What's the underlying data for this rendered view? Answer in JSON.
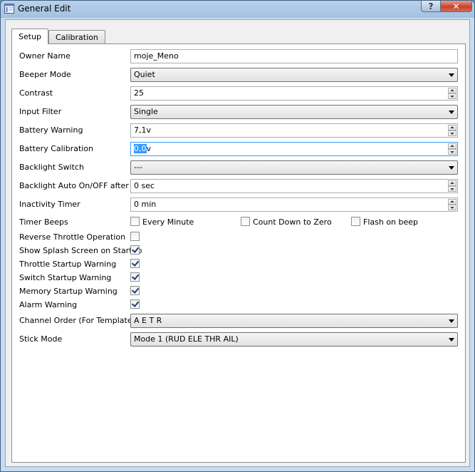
{
  "window": {
    "title": "General Edit",
    "help_label": "?",
    "close_label": "✕"
  },
  "tabs": [
    {
      "label": "Setup",
      "active": true
    },
    {
      "label": "Calibration",
      "active": false
    }
  ],
  "form": {
    "owner_name": {
      "label": "Owner Name",
      "value": "moje_Meno"
    },
    "beeper_mode": {
      "label": "Beeper Mode",
      "value": "Quiet"
    },
    "contrast": {
      "label": "Contrast",
      "value": "25"
    },
    "input_filter": {
      "label": "Input Filter",
      "value": "Single"
    },
    "battery_warning": {
      "label": "Battery Warning",
      "value": "7,1v"
    },
    "battery_calibration": {
      "label": "Battery Calibration",
      "value_selected": "0,0",
      "value_rest": "v"
    },
    "backlight_switch": {
      "label": "Backlight Switch",
      "value": "---"
    },
    "backlight_auto": {
      "label": "Backlight Auto On/OFF after",
      "value": "0 sec"
    },
    "inactivity_timer": {
      "label": "Inactivity Timer",
      "value": "0 min"
    },
    "timer_beeps": {
      "label": "Timer Beeps",
      "options": [
        {
          "label": "Every Minute",
          "checked": false
        },
        {
          "label": "Count Down to Zero",
          "checked": false
        },
        {
          "label": "Flash on beep",
          "checked": false
        }
      ]
    },
    "checks": [
      {
        "label": "Reverse Throttle Operation",
        "checked": false
      },
      {
        "label": "Show Splash Screen on Startup",
        "checked": true
      },
      {
        "label": "Throttle Startup Warning",
        "checked": true
      },
      {
        "label": "Switch Startup Warning",
        "checked": true
      },
      {
        "label": "Memory Startup Warning",
        "checked": true
      },
      {
        "label": "Alarm Warning",
        "checked": true
      }
    ],
    "channel_order": {
      "label": "Channel Order (For Templates)",
      "value": "A E T R"
    },
    "stick_mode": {
      "label": "Stick Mode",
      "value": "Mode 1 (RUD ELE THR AIL)"
    }
  },
  "icons": {
    "app": "app-window-icon",
    "arrow": "chevron-down-icon",
    "spin": "spin-arrows-icon",
    "check": "checkmark-icon"
  }
}
